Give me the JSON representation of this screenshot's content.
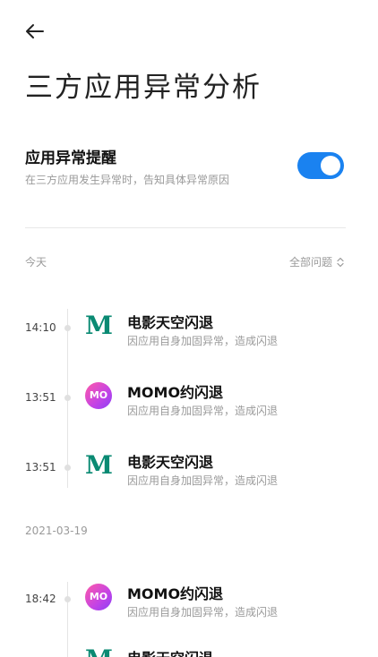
{
  "page": {
    "title": "三方应用异常分析"
  },
  "toggle_setting": {
    "title": "应用异常提醒",
    "description": "在三方应用发生异常时，告知具体异常原因",
    "enabled": true,
    "accent_color": "#1a82f0"
  },
  "filter": {
    "label": "全部问题",
    "icon": "sort-updown-icon"
  },
  "groups": [
    {
      "date_label": "今天",
      "entries": [
        {
          "time": "14:10",
          "app_icon": "M",
          "title": "电影天空闪退",
          "description": "因应用自身加固异常，造成闪退"
        },
        {
          "time": "13:51",
          "app_icon": "MO",
          "title": "MOMO约闪退",
          "description": "因应用自身加固异常，造成闪退"
        },
        {
          "time": "13:51",
          "app_icon": "M",
          "title": "电影天空闪退",
          "description": "因应用自身加固异常，造成闪退"
        }
      ]
    },
    {
      "date_label": "2021-03-19",
      "entries": [
        {
          "time": "18:42",
          "app_icon": "MO",
          "title": "MOMO约闪退",
          "description": "因应用自身加固异常，造成闪退"
        },
        {
          "time": "",
          "app_icon": "M",
          "title": "电影天空闪退",
          "description": ""
        }
      ]
    }
  ]
}
